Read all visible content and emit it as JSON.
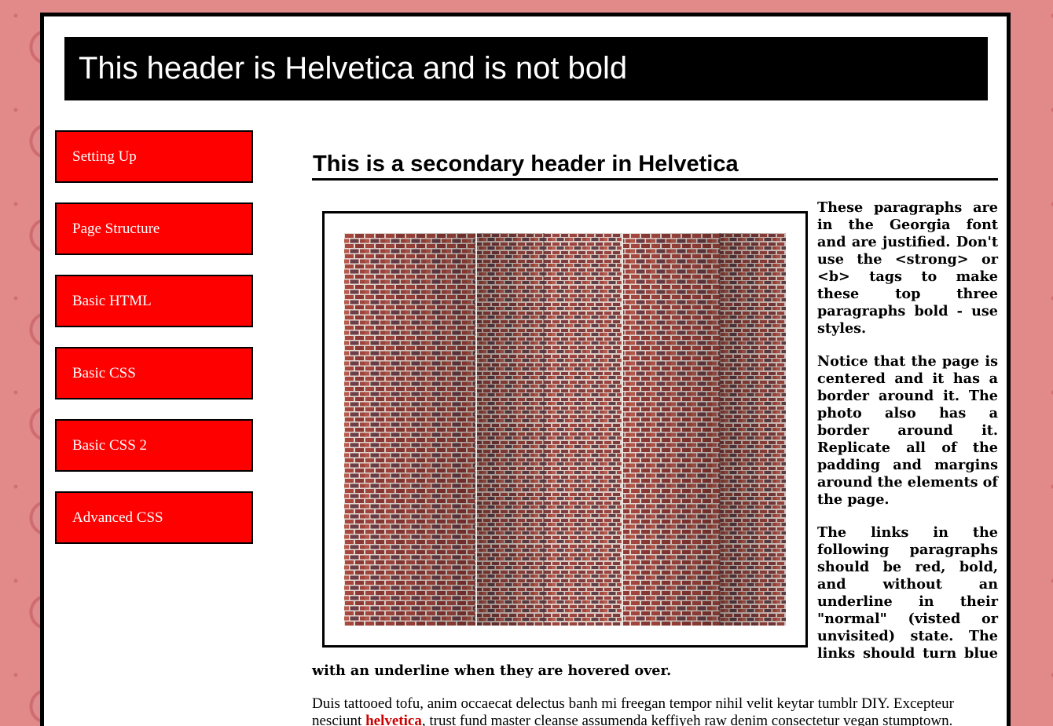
{
  "header": {
    "title": "This header is Helvetica and is not bold"
  },
  "nav": {
    "items": [
      {
        "label": "Setting Up"
      },
      {
        "label": "Page Structure"
      },
      {
        "label": "Basic HTML"
      },
      {
        "label": "Basic CSS"
      },
      {
        "label": "Basic CSS 2"
      },
      {
        "label": "Advanced CSS"
      }
    ]
  },
  "main": {
    "subheader": "This is a secondary header in Helvetica",
    "paragraphs": [
      "These paragraphs are in the Georgia font and are justified. Don't use the <strong> or <b> tags to make these top three paragraphs bold - use styles.",
      "Notice that the page is centered and it has a border around it. The photo also has a border around it. Replicate all of the padding and margins around the elements of the page.",
      "The links in the following paragraphs should be red, bold, and without an underline in their \"normal\" (visted or unvisited) state. The links should turn blue with an underline when they are hovered over."
    ],
    "body_text": {
      "before_link": "Duis tattooed tofu, anim occaecat delectus banh mi freegan tempor nihil velit keytar tumblr DIY. Excepteur nesciunt ",
      "link": "helvetica",
      "after_link": ", trust fund master cleanse assumenda keffiyeh raw denim consectetur vegan stumptown."
    }
  },
  "colors": {
    "page_background": "#e28a8a",
    "nav_background": "#ff0000",
    "header_background": "#000000",
    "link": "#cc0000"
  }
}
